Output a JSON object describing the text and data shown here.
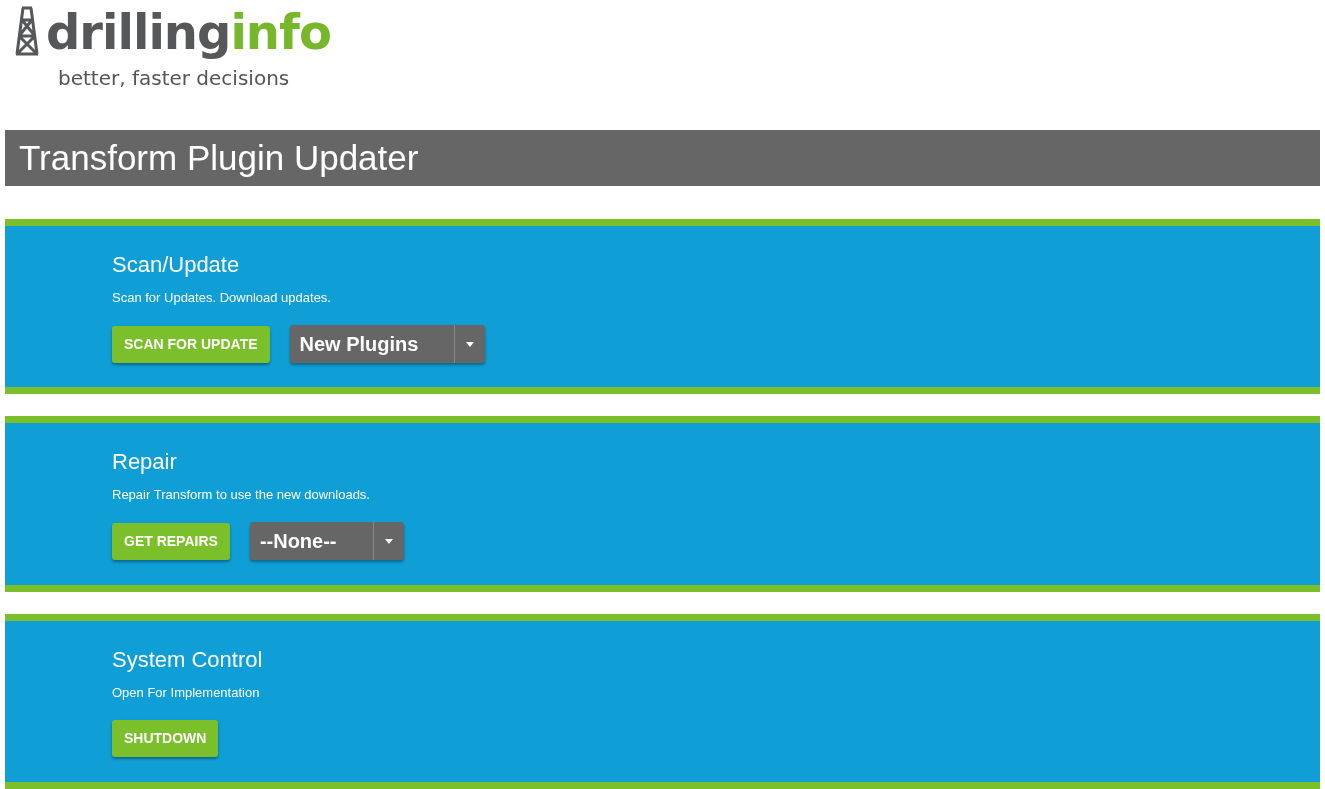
{
  "logo": {
    "word_dark": "drilling",
    "word_green": "info",
    "tagline": "better, faster decisions"
  },
  "title": "Transform Plugin Updater",
  "sections": [
    {
      "title": "Scan/Update",
      "description": "Scan for Updates. Download updates.",
      "button": "SCAN FOR UPDATE",
      "dropdown": {
        "value": "New Plugins"
      }
    },
    {
      "title": "Repair",
      "description": "Repair Transform to use the new downloads.",
      "button": "GET REPAIRS",
      "dropdown": {
        "value": "--None--"
      }
    },
    {
      "title": "System Control",
      "description": "Open For Implementation",
      "button": "SHUTDOWN"
    }
  ]
}
